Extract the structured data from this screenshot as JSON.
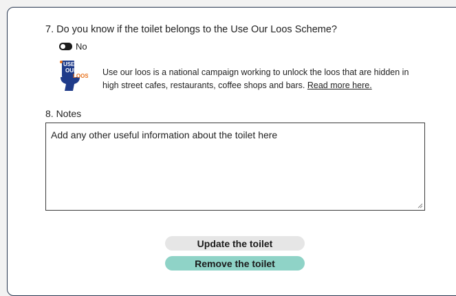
{
  "question7": {
    "label": "7. Do you know if the toilet belongs to the Use Our Loos Scheme?",
    "toggle_value": "No"
  },
  "use_our_loos": {
    "logo_lines": [
      "USE",
      "OUR",
      "LOOS"
    ],
    "description_line1": "Use our loos is a national campaign working to unlock the loos that are hidden in",
    "description_line2": "high street cafes, restaurants, coffee shops and bars.",
    "read_more_link": "Read more here."
  },
  "question8": {
    "label": "8. Notes",
    "placeholder": "Add any other useful information about the toilet here"
  },
  "buttons": {
    "update_label": "Update the toilet",
    "remove_label": "Remove the toilet"
  },
  "colors": {
    "card_border": "#27364f",
    "update_button_bg": "#e6e6e6",
    "remove_button_bg": "#8fd3c7",
    "logo_blue": "#1f3b8a",
    "logo_orange": "#e8721c"
  }
}
